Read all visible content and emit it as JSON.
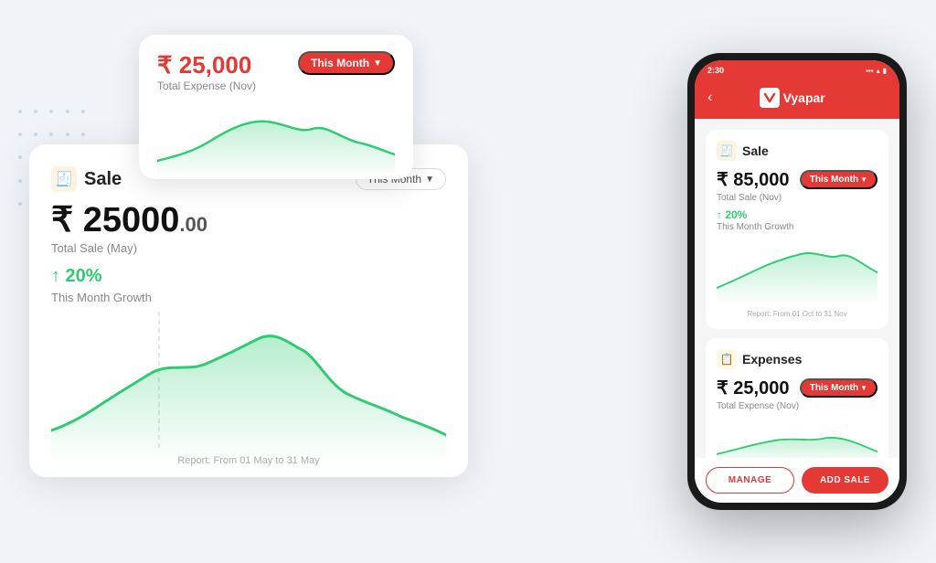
{
  "expense_card": {
    "amount": "₹ 25,000",
    "badge": "This Month",
    "label": "Total Expense (Nov)"
  },
  "sale_card": {
    "title": "Sale",
    "amount_whole": "₹ 25000",
    "amount_decimal": ".00",
    "label": "Total Sale (May)",
    "growth": "↑ 20%",
    "growth_label": "This Month Growth",
    "badge": "This Month",
    "report_label": "Report: From 01 May to 31 May"
  },
  "phone": {
    "time": "2:30",
    "app_name": "Vyapar",
    "sale_section": {
      "title": "Sale",
      "amount": "₹ 85,000",
      "badge": "This Month",
      "label": "Total Sale (Nov)",
      "growth": "↑ 20%",
      "growth_label": "This Month Growth",
      "report_label": "Report: From 01 Oct to 31 Nov"
    },
    "expense_section": {
      "title": "Expenses",
      "amount": "₹ 25,000",
      "badge": "This Month",
      "label": "Total Expense (Nov)"
    },
    "manage_btn": "MANAGE",
    "add_sale_btn": "ADD SALE"
  }
}
